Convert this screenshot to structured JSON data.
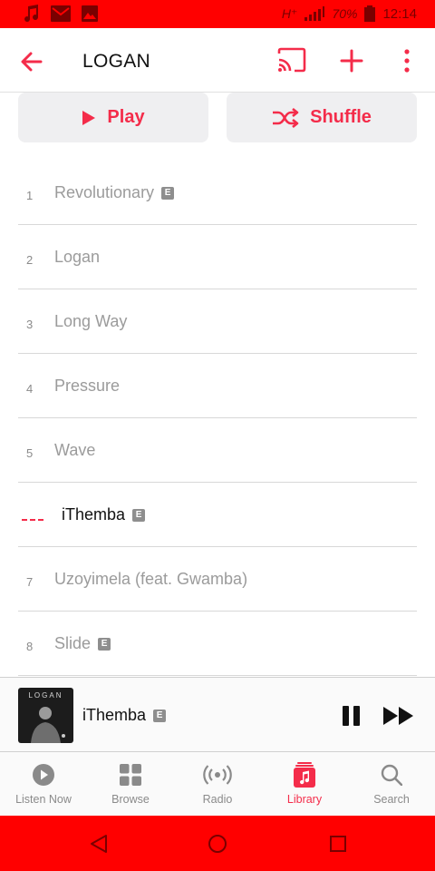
{
  "status_bar": {
    "network": "H⁺",
    "battery": "70%",
    "time": "12:14"
  },
  "header": {
    "title": "LOGAN"
  },
  "actions": {
    "play_label": "Play",
    "shuffle_label": "Shuffle"
  },
  "tracks": [
    {
      "number": "1",
      "title": "Revolutionary",
      "explicit": "E"
    },
    {
      "number": "2",
      "title": "Logan"
    },
    {
      "number": "3",
      "title": "Long Way"
    },
    {
      "number": "4",
      "title": "Pressure"
    },
    {
      "number": "5",
      "title": "Wave"
    },
    {
      "number": "",
      "title": "iThemba",
      "explicit": "E",
      "now_playing": true
    },
    {
      "number": "7",
      "title": "Uzoyimela (feat. Gwamba)"
    },
    {
      "number": "8",
      "title": "Slide",
      "explicit": "E"
    }
  ],
  "mini_player": {
    "art_text": "LOGAN",
    "title": "iThemba",
    "explicit": "E"
  },
  "tabs": [
    {
      "label": "Listen Now",
      "icon": "play-circle-icon"
    },
    {
      "label": "Browse",
      "icon": "grid-icon"
    },
    {
      "label": "Radio",
      "icon": "radio-icon"
    },
    {
      "label": "Library",
      "icon": "music-note-icon",
      "active": true
    },
    {
      "label": "Search",
      "icon": "search-icon"
    }
  ],
  "colors": {
    "accent": "#f42c4a",
    "status_bar": "#ff0000",
    "muted_text": "#9b9b9b"
  }
}
